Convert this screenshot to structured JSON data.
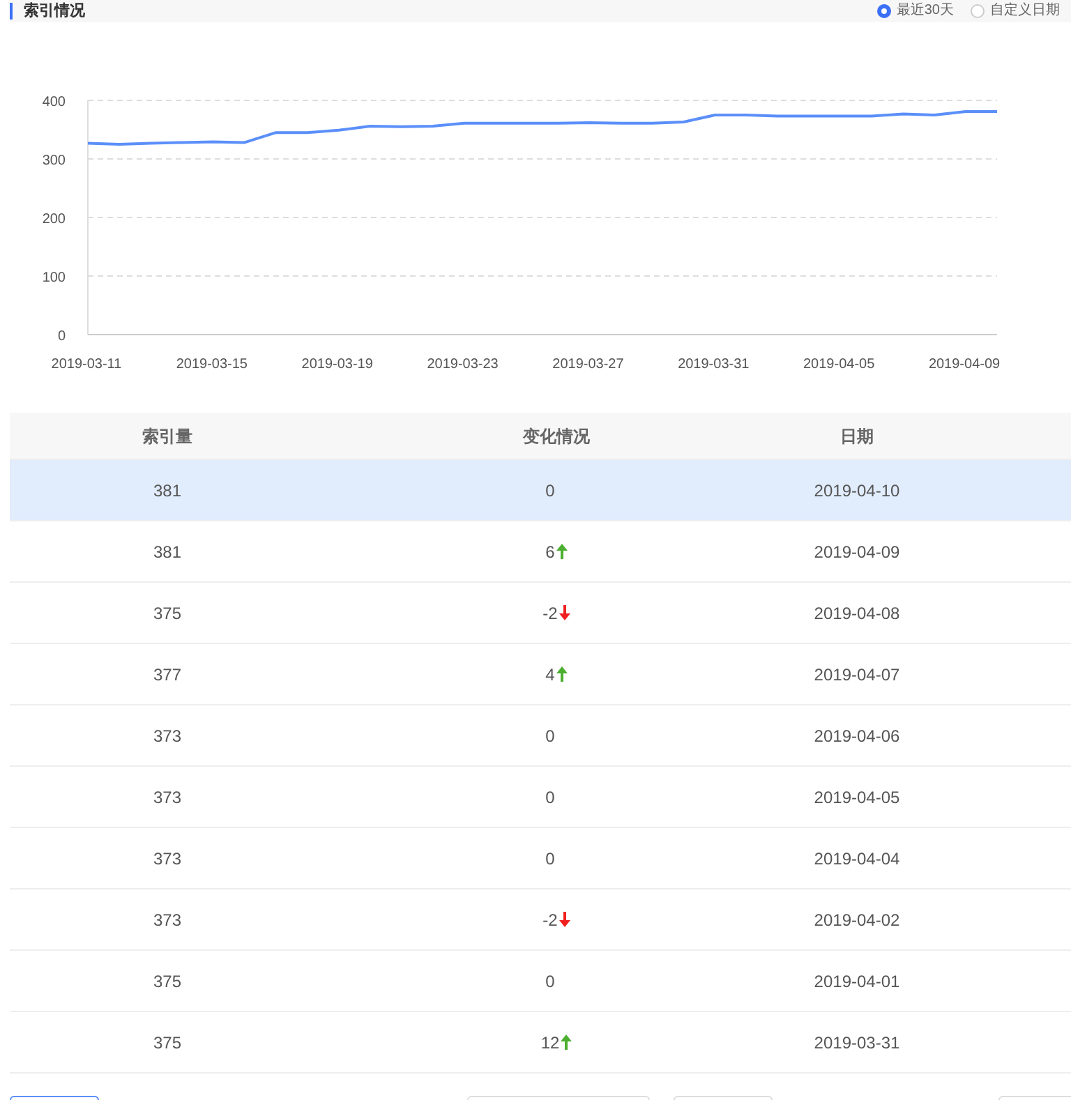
{
  "header": {
    "title": "索引情况",
    "ranges": [
      {
        "label": "最近30天",
        "selected": true
      },
      {
        "label": "自定义日期",
        "selected": false
      }
    ]
  },
  "chart": {
    "chart_data": {
      "type": "line",
      "categories": [
        "2019-03-11",
        null,
        null,
        null,
        "2019-03-15",
        null,
        null,
        null,
        "2019-03-19",
        null,
        null,
        null,
        "2019-03-23",
        null,
        null,
        null,
        "2019-03-27",
        null,
        null,
        null,
        "2019-03-31",
        null,
        null,
        null,
        "2019-04-05",
        null,
        null,
        null,
        "2019-04-09",
        null
      ],
      "values": [
        327,
        325,
        327,
        328,
        329,
        328,
        345,
        345,
        349,
        356,
        355,
        356,
        361,
        361,
        361,
        361,
        362,
        361,
        361,
        363,
        375,
        375,
        373,
        373,
        373,
        373,
        377,
        375,
        381,
        381
      ],
      "ylim": [
        0,
        400
      ],
      "yticks": [
        0,
        100,
        200,
        300,
        400
      ],
      "grid": true
    }
  },
  "table": {
    "columns": [
      "索引量",
      "变化情况",
      "日期"
    ],
    "rows": [
      {
        "count": "381",
        "change": "0",
        "kind": "flat",
        "date": "2019-04-10",
        "selected": true
      },
      {
        "count": "381",
        "change": "6",
        "kind": "up",
        "date": "2019-04-09",
        "selected": false
      },
      {
        "count": "375",
        "change": "-2",
        "kind": "down",
        "date": "2019-04-08",
        "selected": false
      },
      {
        "count": "377",
        "change": "4",
        "kind": "up",
        "date": "2019-04-07",
        "selected": false
      },
      {
        "count": "373",
        "change": "0",
        "kind": "flat",
        "date": "2019-04-06",
        "selected": false
      },
      {
        "count": "373",
        "change": "0",
        "kind": "flat",
        "date": "2019-04-05",
        "selected": false
      },
      {
        "count": "373",
        "change": "0",
        "kind": "flat",
        "date": "2019-04-04",
        "selected": false
      },
      {
        "count": "373",
        "change": "-2",
        "kind": "down",
        "date": "2019-04-02",
        "selected": false
      },
      {
        "count": "375",
        "change": "0",
        "kind": "flat",
        "date": "2019-04-01",
        "selected": false
      },
      {
        "count": "375",
        "change": "12",
        "kind": "up",
        "date": "2019-03-31",
        "selected": false
      }
    ]
  }
}
